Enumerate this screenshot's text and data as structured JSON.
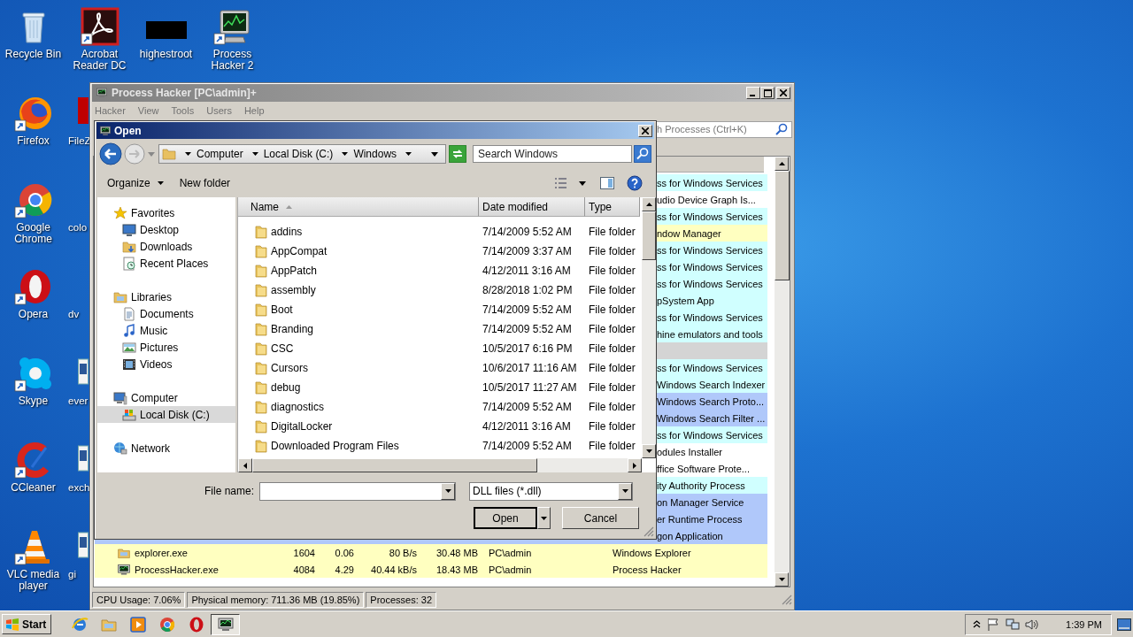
{
  "desktop": {
    "columns": [
      [
        {
          "label": "Recycle Bin",
          "kind": "recycle"
        },
        {
          "label": "Firefox",
          "kind": "firefox"
        },
        {
          "label": "Google Chrome",
          "kind": "chrome"
        },
        {
          "label": "Opera",
          "kind": "opera"
        },
        {
          "label": "Skype",
          "kind": "skype"
        },
        {
          "label": "CCleaner",
          "kind": "ccleaner"
        },
        {
          "label": "VLC media player",
          "kind": "vlc"
        }
      ],
      [
        {
          "label": "Acrobat Reader DC",
          "kind": "acrobat"
        },
        {
          "label": "FileZ",
          "kind": "filezilla"
        },
        {
          "label": "colo",
          "kind": "label-only"
        },
        {
          "label": "dv",
          "kind": "label-only"
        },
        {
          "label": "ever",
          "kind": "doc"
        },
        {
          "label": "exch",
          "kind": "doc"
        },
        {
          "label": "gi",
          "kind": "doc"
        }
      ],
      [
        {
          "label": "highestroot",
          "kind": "black"
        }
      ],
      [
        {
          "label": "Process Hacker 2",
          "kind": "processhacker"
        }
      ]
    ]
  },
  "process_hacker": {
    "title": "Process Hacker [PC\\admin]+",
    "menu": [
      "Hacker",
      "View",
      "Tools",
      "Users",
      "Help"
    ],
    "search": {
      "placeholder": "h Processes (Ctrl+K)"
    },
    "rows": [
      {
        "kind": "partial",
        "color": "#d0ffff",
        "cells": [
          "ss for Windows Services"
        ]
      },
      {
        "kind": "partial",
        "color": "#ffffff",
        "cells": [
          "udio Device Graph Is..."
        ]
      },
      {
        "kind": "partial",
        "color": "#d0ffff",
        "cells": [
          "ss for Windows Services"
        ]
      },
      {
        "kind": "partial",
        "color": "#ffffc0",
        "cells": [
          "ndow Manager"
        ]
      },
      {
        "kind": "partial",
        "color": "#d0ffff",
        "cells": [
          "ss for Windows Services"
        ]
      },
      {
        "kind": "partial",
        "color": "#d0ffff",
        "cells": [
          "ss for Windows Services"
        ]
      },
      {
        "kind": "partial",
        "color": "#d0ffff",
        "cells": [
          "ss for Windows Services"
        ]
      },
      {
        "kind": "partial",
        "color": "#d0ffff",
        "cells": [
          "pSystem App"
        ]
      },
      {
        "kind": "partial",
        "color": "#d0ffff",
        "cells": [
          "ss for Windows Services"
        ]
      },
      {
        "kind": "partial",
        "color": "#d0ffff",
        "cells": [
          "hine emulators and tools"
        ]
      },
      {
        "kind": "blank",
        "color": "#d4d4d4"
      },
      {
        "kind": "partial",
        "color": "#d0ffff",
        "cells": [
          "ss for Windows Services"
        ]
      },
      {
        "kind": "partial",
        "color": "#d0ffff",
        "cells": [
          "Windows Search Indexer"
        ]
      },
      {
        "kind": "partial",
        "color": "#b0c8fa",
        "cells": [
          "Windows Search Proto..."
        ]
      },
      {
        "kind": "partial",
        "color": "#b0c8fa",
        "cells": [
          "Windows Search Filter ..."
        ]
      },
      {
        "kind": "partial",
        "color": "#d0ffff",
        "cells": [
          "ss for Windows Services"
        ]
      },
      {
        "kind": "partial",
        "color": "#ffffff",
        "cells": [
          "odules Installer"
        ]
      },
      {
        "kind": "partial",
        "color": "#ffffff",
        "cells": [
          "ffice Software Prote..."
        ]
      },
      {
        "kind": "partial",
        "color": "#d0ffff",
        "cells": [
          "ity Authority Process"
        ]
      },
      {
        "kind": "partial",
        "color": "#b0c8fa",
        "cells": [
          "on Manager Service"
        ]
      },
      {
        "kind": "partial",
        "color": "#b0c8fa",
        "cells": [
          "er Runtime Process"
        ]
      },
      {
        "kind": "partial",
        "color": "#b0c8fa",
        "cells": [
          "gon Application"
        ]
      },
      {
        "kind": "full",
        "color": "#ffffc0",
        "cells": [
          "explorer.exe",
          "1604",
          "0.06",
          "80 B/s",
          "30.48 MB",
          "PC\\admin",
          "Windows Explorer"
        ]
      },
      {
        "kind": "full",
        "color": "#ffffc0",
        "cells": [
          "ProcessHacker.exe",
          "4084",
          "4.29",
          "40.44 kB/s",
          "18.43 MB",
          "PC\\admin",
          "Process Hacker"
        ]
      }
    ],
    "status_bar": [
      "CPU Usage: 7.06%",
      "Physical memory: 711.36 MB (19.85%)",
      "Processes: 32"
    ]
  },
  "open_dialog": {
    "title": "Open",
    "breadcrumb": [
      "Computer",
      "Local Disk (C:)",
      "Windows"
    ],
    "search": {
      "placeholder": "Search Windows"
    },
    "toolbar": [
      "Organize",
      "New folder"
    ],
    "nav": [
      {
        "label": "Favorites",
        "kind": "favorites",
        "selected": false,
        "children": [
          {
            "label": "Desktop",
            "kind": "desktop",
            "selected": false
          },
          {
            "label": "Downloads",
            "kind": "downloads",
            "selected": false
          },
          {
            "label": "Recent Places",
            "kind": "recent",
            "selected": false
          }
        ]
      },
      {
        "label": "Libraries",
        "kind": "libraries",
        "selected": false,
        "children": [
          {
            "label": "Documents",
            "kind": "documents",
            "selected": false
          },
          {
            "label": "Music",
            "kind": "music",
            "selected": false
          },
          {
            "label": "Pictures",
            "kind": "pictures",
            "selected": false
          },
          {
            "label": "Videos",
            "kind": "videos",
            "selected": false
          }
        ]
      },
      {
        "label": "Computer",
        "kind": "computer",
        "selected": false,
        "children": [
          {
            "label": "Local Disk (C:)",
            "kind": "disk",
            "selected": true
          }
        ]
      },
      {
        "label": "Network",
        "kind": "network",
        "selected": false
      }
    ],
    "columns": [
      "Name",
      "Date modified",
      "Type"
    ],
    "files": [
      {
        "name": "addins",
        "date": "7/14/2009 5:52 AM",
        "type": "File folder"
      },
      {
        "name": "AppCompat",
        "date": "7/14/2009 3:37 AM",
        "type": "File folder"
      },
      {
        "name": "AppPatch",
        "date": "4/12/2011 3:16 AM",
        "type": "File folder"
      },
      {
        "name": "assembly",
        "date": "8/28/2018 1:02 PM",
        "type": "File folder"
      },
      {
        "name": "Boot",
        "date": "7/14/2009 5:52 AM",
        "type": "File folder"
      },
      {
        "name": "Branding",
        "date": "7/14/2009 5:52 AM",
        "type": "File folder"
      },
      {
        "name": "CSC",
        "date": "10/5/2017 6:16 PM",
        "type": "File folder"
      },
      {
        "name": "Cursors",
        "date": "10/6/2017 11:16 AM",
        "type": "File folder"
      },
      {
        "name": "debug",
        "date": "10/5/2017 11:27 AM",
        "type": "File folder"
      },
      {
        "name": "diagnostics",
        "date": "7/14/2009 5:52 AM",
        "type": "File folder"
      },
      {
        "name": "DigitalLocker",
        "date": "4/12/2011 3:16 AM",
        "type": "File folder"
      },
      {
        "name": "Downloaded Program Files",
        "date": "7/14/2009 5:52 AM",
        "type": "File folder"
      }
    ],
    "file_name_label": "File name:",
    "file_type": "DLL files (*.dll)",
    "buttons": [
      "Open",
      "Cancel"
    ]
  },
  "taskbar": {
    "start": "Start",
    "apps": [
      {
        "kind": "ie",
        "selected": false
      },
      {
        "kind": "folder",
        "selected": false
      },
      {
        "kind": "media",
        "selected": false
      },
      {
        "kind": "chrome",
        "selected": false
      },
      {
        "kind": "opera",
        "selected": false
      },
      {
        "kind": "processhacker",
        "selected": true
      }
    ],
    "clock": "1:39 PM"
  }
}
